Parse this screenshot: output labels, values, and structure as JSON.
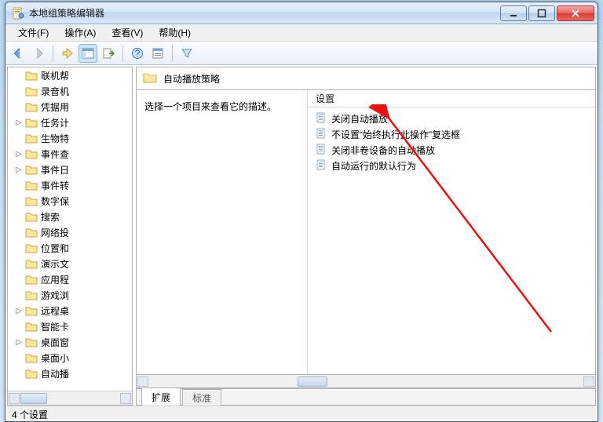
{
  "window": {
    "title": "本地组策略编辑器"
  },
  "menu": {
    "file": "文件(F)",
    "action": "操作(A)",
    "view": "查看(V)",
    "help": "帮助(H)"
  },
  "tree": {
    "items": [
      {
        "exp": "",
        "label": "联机帮"
      },
      {
        "exp": "",
        "label": "录音机"
      },
      {
        "exp": "",
        "label": "凭据用"
      },
      {
        "exp": "▷",
        "label": "任务计"
      },
      {
        "exp": "",
        "label": "生物特"
      },
      {
        "exp": "▷",
        "label": "事件查"
      },
      {
        "exp": "▷",
        "label": "事件日"
      },
      {
        "exp": "",
        "label": "事件转"
      },
      {
        "exp": "",
        "label": "数字保"
      },
      {
        "exp": "",
        "label": "搜索"
      },
      {
        "exp": "",
        "label": "网络投"
      },
      {
        "exp": "",
        "label": "位置和"
      },
      {
        "exp": "",
        "label": "演示文"
      },
      {
        "exp": "",
        "label": "应用程"
      },
      {
        "exp": "",
        "label": "游戏浏"
      },
      {
        "exp": "▷",
        "label": "远程桌"
      },
      {
        "exp": "",
        "label": "智能卡"
      },
      {
        "exp": "▷",
        "label": "桌面窗"
      },
      {
        "exp": "",
        "label": "桌面小"
      },
      {
        "exp": "",
        "label": "自动播"
      }
    ]
  },
  "header": {
    "title": "自动播放策略"
  },
  "description": {
    "hint": "选择一个项目来查看它的描述。"
  },
  "list": {
    "column": "设置",
    "rows": [
      "关闭自动播放",
      "不设置“始终执行此操作”复选框",
      "关闭非卷设备的自动播放",
      "自动运行的默认行为"
    ]
  },
  "tabs": {
    "extended": "扩展",
    "standard": "标准"
  },
  "status": {
    "text": "4 个设置"
  }
}
